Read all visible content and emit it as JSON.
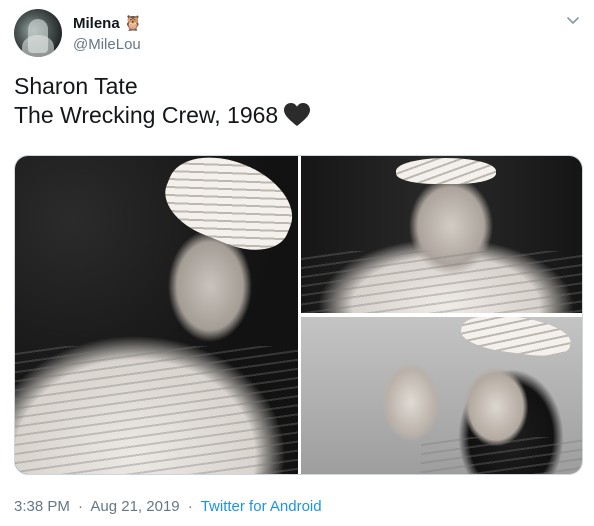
{
  "author": {
    "display_name": "Milena",
    "name_emoji": "🦉",
    "handle": "@MileLou",
    "avatar_icon": "avatar-photo"
  },
  "tweet": {
    "text_lines": [
      "Sharon Tate",
      "The Wrecking Crew, 1968"
    ],
    "emoji": "black-heart-icon",
    "images": [
      {
        "subject": "woman-in-striped-hat-portrait"
      },
      {
        "subject": "woman-smiling-hands-behind-head"
      },
      {
        "subject": "two-women-portrait"
      }
    ],
    "time": "3:38 PM",
    "separator": "·",
    "date": "Aug 21, 2019",
    "source": "Twitter for Android"
  },
  "colors": {
    "text": "#14171a",
    "secondary": "#657786",
    "link": "#1b95e0",
    "border": "#ccd6dd"
  }
}
